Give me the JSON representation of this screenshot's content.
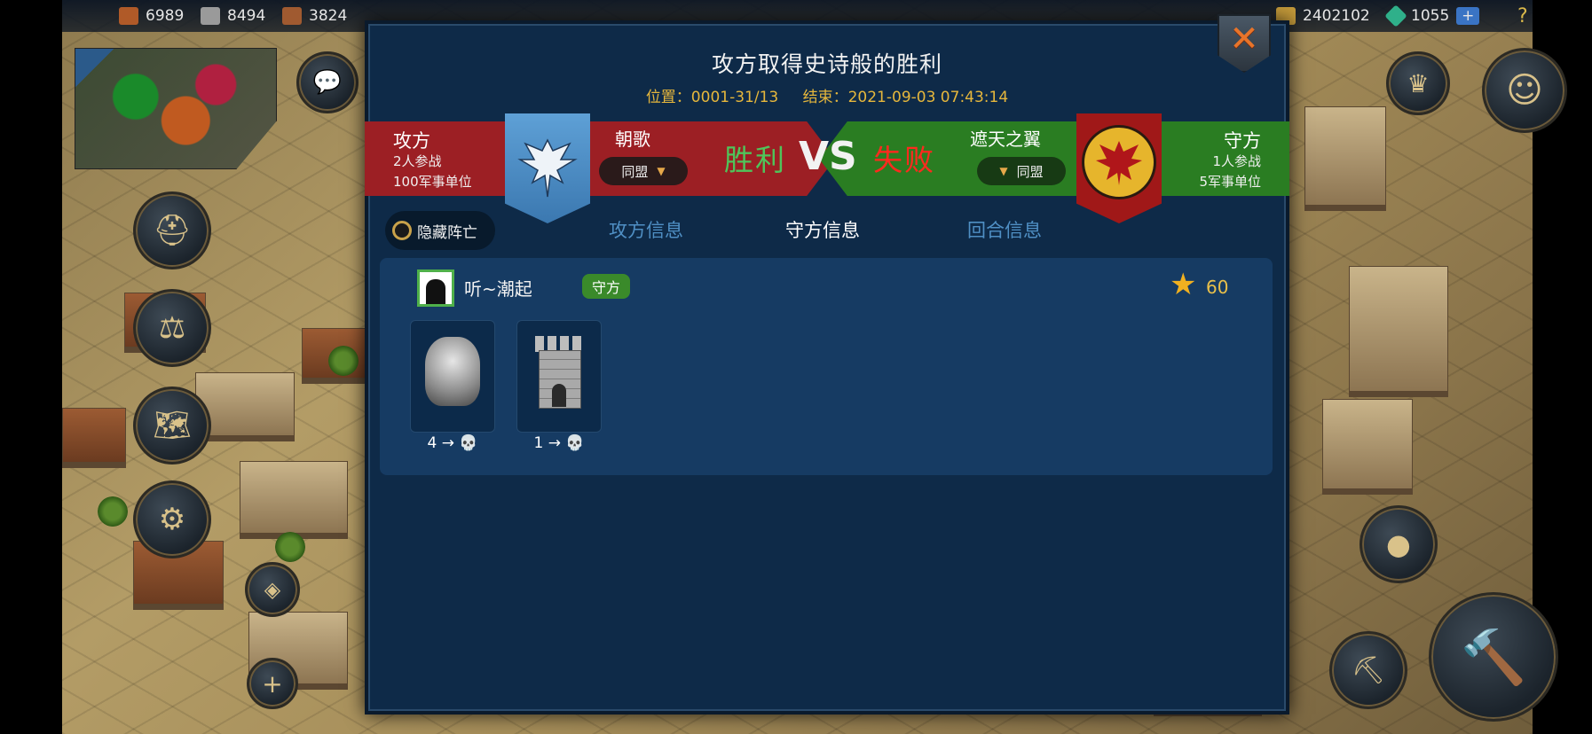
{
  "topbar": {
    "resources": [
      {
        "icon": "wood-icon",
        "value": "6989",
        "color": "#b05a28"
      },
      {
        "icon": "stone-icon",
        "value": "8494",
        "color": "#9a9a9a"
      },
      {
        "icon": "iron-icon",
        "value": "3824",
        "color": "#a05a30"
      }
    ],
    "right": [
      {
        "icon": "gold-icon",
        "value": "2402102",
        "color": "#c49a3a"
      },
      {
        "icon": "gem-icon",
        "value": "1055",
        "color": "#2fb08a"
      }
    ],
    "add_label": "+",
    "help_label": "?"
  },
  "modal": {
    "title": "攻方取得史诗般的胜利",
    "location": "位置：0001-31/13",
    "end_time": "结束：2021-09-03 07:43:14",
    "close_label": "✕"
  },
  "attacker": {
    "title": "攻方",
    "participants": "2人参战",
    "units": "100军事单位",
    "alliance": "朝歌",
    "alliance_pill": "同盟",
    "result": "胜利"
  },
  "vs": "VS",
  "defender": {
    "title": "守方",
    "participants": "1人参战",
    "units": "5军事单位",
    "alliance": "遮天之翼",
    "alliance_pill": "同盟",
    "result": "失败"
  },
  "controls": {
    "hide_dead": "隐藏阵亡"
  },
  "tabs": {
    "attacker": "攻方信息",
    "defender": "守方信息",
    "rounds": "回合信息"
  },
  "player": {
    "name": "听~潮起",
    "role": "守方",
    "score": "60"
  },
  "units": [
    {
      "icon": "ogre-unit-icon",
      "stat": "4 → 💀"
    },
    {
      "icon": "tower-unit-icon",
      "stat": "1 → 💀"
    }
  ]
}
